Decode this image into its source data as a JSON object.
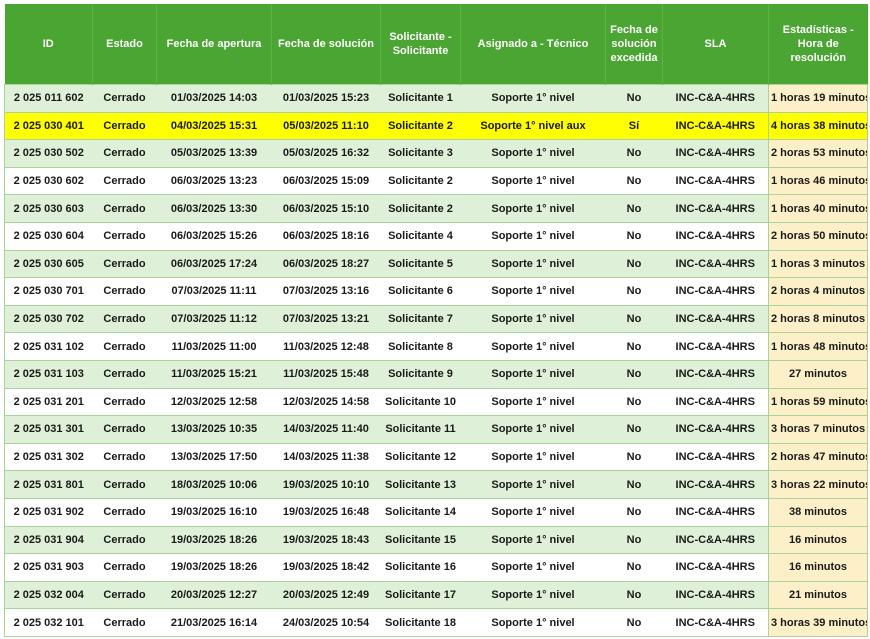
{
  "columns": [
    "ID",
    "Estado",
    "Fecha de apertura",
    "Fecha de solución",
    "Solicitante - Solicitante",
    "Asignado a - Técnico",
    "Fecha de solución excedida",
    "SLA",
    "Estadísticas - Hora de resolución"
  ],
  "highlight_color": "#ffff00",
  "header_color": "#4aa532",
  "rows": [
    {
      "id": "2 025 011 602",
      "estado": "Cerrado",
      "apertura": "01/03/2025 14:03",
      "solucion": "01/03/2025 15:23",
      "solicitante": "Solicitante 1",
      "tecnico": "Soporte 1° nivel",
      "excedida": "No",
      "sla": "INC-C&A-4HRS",
      "resolucion": "1 horas 19 minutos",
      "highlight": false
    },
    {
      "id": "2 025 030 401",
      "estado": "Cerrado",
      "apertura": "04/03/2025 15:31",
      "solucion": "05/03/2025 11:10",
      "solicitante": "Solicitante 2",
      "tecnico": "Soporte 1° nivel aux",
      "excedida": "Sí",
      "sla": "INC-C&A-4HRS",
      "resolucion": "4 horas 38 minutos",
      "highlight": true
    },
    {
      "id": "2 025 030 502",
      "estado": "Cerrado",
      "apertura": "05/03/2025 13:39",
      "solucion": "05/03/2025 16:32",
      "solicitante": "Solicitante 3",
      "tecnico": "Soporte 1° nivel",
      "excedida": "No",
      "sla": "INC-C&A-4HRS",
      "resolucion": "2 horas 53 minutos",
      "highlight": false
    },
    {
      "id": "2 025 030 602",
      "estado": "Cerrado",
      "apertura": "06/03/2025 13:23",
      "solucion": "06/03/2025 15:09",
      "solicitante": "Solicitante 2",
      "tecnico": "Soporte 1° nivel",
      "excedida": "No",
      "sla": "INC-C&A-4HRS",
      "resolucion": "1 horas 46 minutos",
      "highlight": false
    },
    {
      "id": "2 025 030 603",
      "estado": "Cerrado",
      "apertura": "06/03/2025 13:30",
      "solucion": "06/03/2025 15:10",
      "solicitante": "Solicitante 2",
      "tecnico": "Soporte 1° nivel",
      "excedida": "No",
      "sla": "INC-C&A-4HRS",
      "resolucion": "1 horas 40 minutos",
      "highlight": false
    },
    {
      "id": "2 025 030 604",
      "estado": "Cerrado",
      "apertura": "06/03/2025 15:26",
      "solucion": "06/03/2025 18:16",
      "solicitante": "Solicitante 4",
      "tecnico": "Soporte 1° nivel",
      "excedida": "No",
      "sla": "INC-C&A-4HRS",
      "resolucion": "2 horas 50 minutos",
      "highlight": false
    },
    {
      "id": "2 025 030 605",
      "estado": "Cerrado",
      "apertura": "06/03/2025 17:24",
      "solucion": "06/03/2025 18:27",
      "solicitante": "Solicitante 5",
      "tecnico": "Soporte 1° nivel",
      "excedida": "No",
      "sla": "INC-C&A-4HRS",
      "resolucion": "1 horas 3 minutos",
      "highlight": false
    },
    {
      "id": "2 025 030 701",
      "estado": "Cerrado",
      "apertura": "07/03/2025 11:11",
      "solucion": "07/03/2025 13:16",
      "solicitante": "Solicitante 6",
      "tecnico": "Soporte 1° nivel",
      "excedida": "No",
      "sla": "INC-C&A-4HRS",
      "resolucion": "2 horas 4 minutos",
      "highlight": false
    },
    {
      "id": "2 025 030 702",
      "estado": "Cerrado",
      "apertura": "07/03/2025 11:12",
      "solucion": "07/03/2025 13:21",
      "solicitante": "Solicitante 7",
      "tecnico": "Soporte 1° nivel",
      "excedida": "No",
      "sla": "INC-C&A-4HRS",
      "resolucion": "2 horas 8 minutos",
      "highlight": false
    },
    {
      "id": "2 025 031 102",
      "estado": "Cerrado",
      "apertura": "11/03/2025 11:00",
      "solucion": "11/03/2025 12:48",
      "solicitante": "Solicitante 8",
      "tecnico": "Soporte 1° nivel",
      "excedida": "No",
      "sla": "INC-C&A-4HRS",
      "resolucion": "1 horas 48 minutos",
      "highlight": false
    },
    {
      "id": "2 025 031 103",
      "estado": "Cerrado",
      "apertura": "11/03/2025 15:21",
      "solucion": "11/03/2025 15:48",
      "solicitante": "Solicitante 9",
      "tecnico": "Soporte 1° nivel",
      "excedida": "No",
      "sla": "INC-C&A-4HRS",
      "resolucion": "27 minutos",
      "highlight": false
    },
    {
      "id": "2 025 031 201",
      "estado": "Cerrado",
      "apertura": "12/03/2025 12:58",
      "solucion": "12/03/2025 14:58",
      "solicitante": "Solicitante 10",
      "tecnico": "Soporte 1° nivel",
      "excedida": "No",
      "sla": "INC-C&A-4HRS",
      "resolucion": "1 horas 59 minutos",
      "highlight": false
    },
    {
      "id": "2 025 031 301",
      "estado": "Cerrado",
      "apertura": "13/03/2025 10:35",
      "solucion": "14/03/2025 11:40",
      "solicitante": "Solicitante 11",
      "tecnico": "Soporte 1° nivel",
      "excedida": "No",
      "sla": "INC-C&A-4HRS",
      "resolucion": "3 horas 7 minutos",
      "highlight": false
    },
    {
      "id": "2 025 031 302",
      "estado": "Cerrado",
      "apertura": "13/03/2025 17:50",
      "solucion": "14/03/2025 11:38",
      "solicitante": "Solicitante 12",
      "tecnico": "Soporte 1° nivel",
      "excedida": "No",
      "sla": "INC-C&A-4HRS",
      "resolucion": "2 horas 47 minutos",
      "highlight": false
    },
    {
      "id": "2 025 031 801",
      "estado": "Cerrado",
      "apertura": "18/03/2025 10:06",
      "solucion": "19/03/2025 10:10",
      "solicitante": "Solicitante 13",
      "tecnico": "Soporte 1° nivel",
      "excedida": "No",
      "sla": "INC-C&A-4HRS",
      "resolucion": "3 horas 22 minutos",
      "highlight": false
    },
    {
      "id": "2 025 031 902",
      "estado": "Cerrado",
      "apertura": "19/03/2025 16:10",
      "solucion": "19/03/2025 16:48",
      "solicitante": "Solicitante 14",
      "tecnico": "Soporte 1° nivel",
      "excedida": "No",
      "sla": "INC-C&A-4HRS",
      "resolucion": "38 minutos",
      "highlight": false
    },
    {
      "id": "2 025 031 904",
      "estado": "Cerrado",
      "apertura": "19/03/2025 18:26",
      "solucion": "19/03/2025 18:43",
      "solicitante": "Solicitante 15",
      "tecnico": "Soporte 1° nivel",
      "excedida": "No",
      "sla": "INC-C&A-4HRS",
      "resolucion": "16 minutos",
      "highlight": false
    },
    {
      "id": "2 025 031 903",
      "estado": "Cerrado",
      "apertura": "19/03/2025 18:26",
      "solucion": "19/03/2025 18:42",
      "solicitante": "Solicitante 16",
      "tecnico": "Soporte 1° nivel",
      "excedida": "No",
      "sla": "INC-C&A-4HRS",
      "resolucion": "16 minutos",
      "highlight": false
    },
    {
      "id": "2 025 032 004",
      "estado": "Cerrado",
      "apertura": "20/03/2025 12:27",
      "solucion": "20/03/2025 12:49",
      "solicitante": "Solicitante 17",
      "tecnico": "Soporte 1° nivel",
      "excedida": "No",
      "sla": "INC-C&A-4HRS",
      "resolucion": "21 minutos",
      "highlight": false
    },
    {
      "id": "2 025 032 101",
      "estado": "Cerrado",
      "apertura": "21/03/2025 16:14",
      "solucion": "24/03/2025 10:54",
      "solicitante": "Solicitante 18",
      "tecnico": "Soporte 1° nivel",
      "excedida": "No",
      "sla": "INC-C&A-4HRS",
      "resolucion": "3 horas 39 minutos",
      "highlight": false
    }
  ]
}
